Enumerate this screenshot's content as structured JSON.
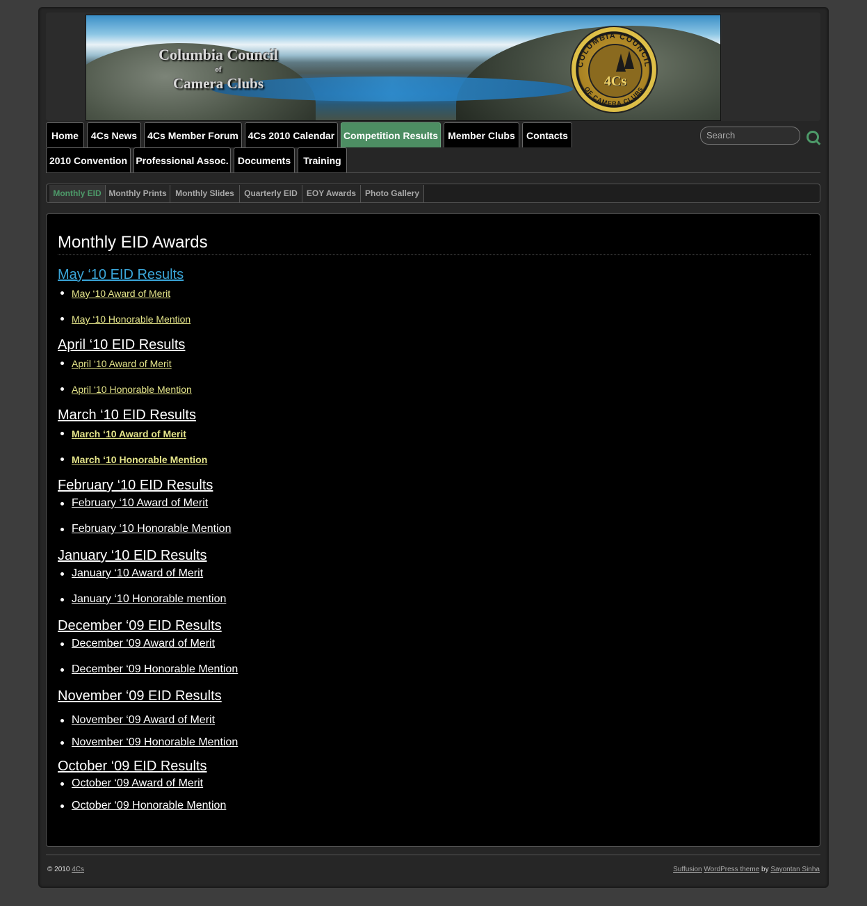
{
  "header": {
    "banner_line1": "Columbia Council",
    "banner_line2": "of",
    "banner_line3": "Camera Clubs",
    "logo_text": "4Cs",
    "logo_ring_top": "COLUMBIA COUNCIL",
    "logo_ring_bottom": "OF CAMERA CLUBS"
  },
  "nav": {
    "items": [
      {
        "label": "Home"
      },
      {
        "label": "4Cs News"
      },
      {
        "label": "4Cs Member Forum"
      },
      {
        "label": "4Cs 2010 Calendar"
      },
      {
        "label": "Competition Results",
        "active": true
      },
      {
        "label": "Member Clubs"
      },
      {
        "label": "Contacts"
      },
      {
        "label": "2010 Convention"
      },
      {
        "label": "Professional Assoc."
      },
      {
        "label": "Documents"
      },
      {
        "label": "Training"
      }
    ],
    "active_color": "#4d8e63"
  },
  "search": {
    "placeholder": "Search",
    "icon": "search-icon"
  },
  "subnav": {
    "items": [
      {
        "label": "Monthly EID",
        "active": true
      },
      {
        "label": "Monthly Prints"
      },
      {
        "label": "Monthly Slides"
      },
      {
        "label": "Quarterly EID"
      },
      {
        "label": "EOY Awards"
      },
      {
        "label": "Photo Gallery"
      }
    ]
  },
  "main": {
    "title": "Monthly EID Awards",
    "sections": [
      {
        "heading": "May ‘10 EID Results",
        "items": [
          "May ‘10 Award of Merit",
          "May ‘10 Honorable Mention"
        ]
      },
      {
        "heading": "April ‘10 EID Results",
        "items": [
          "April ‘10 Award of Merit",
          "April ‘10 Honorable Mention"
        ]
      },
      {
        "heading": "March ‘10 EID Results",
        "items": [
          "March ‘10 Award of Merit",
          "March ‘10 Honorable Mention"
        ]
      },
      {
        "heading": "February ‘10 EID Results",
        "items": [
          "February ‘10 Award of Merit",
          "February ‘10 Honorable Mention"
        ]
      },
      {
        "heading": "January ‘10 EID Results",
        "items": [
          "January ‘10 Award of Merit",
          "January ‘10 Honorable mention"
        ]
      },
      {
        "heading": "December ‘09 EID Results",
        "items": [
          "December ‘09 Award of Merit",
          "December ‘09 Honorable Mention"
        ]
      },
      {
        "heading": "November ‘09 EID Results",
        "items": [
          "November ‘09 Award of Merit",
          "November ‘09 Honorable Mention"
        ]
      },
      {
        "heading": "October ‘09 EID Results",
        "items": [
          "October ‘09 Award of Merit",
          "October ‘09 Honorable Mention"
        ]
      }
    ],
    "link_color_blue": "#3aa5d8",
    "link_color_yellow": "#e5e58a"
  },
  "footer": {
    "copyright": "© 2010",
    "site_link": "4Cs",
    "theme_link": "Suffusion",
    "theme_text": "WordPress theme",
    "by": "by",
    "author_link": "Sayontan Sinha"
  }
}
